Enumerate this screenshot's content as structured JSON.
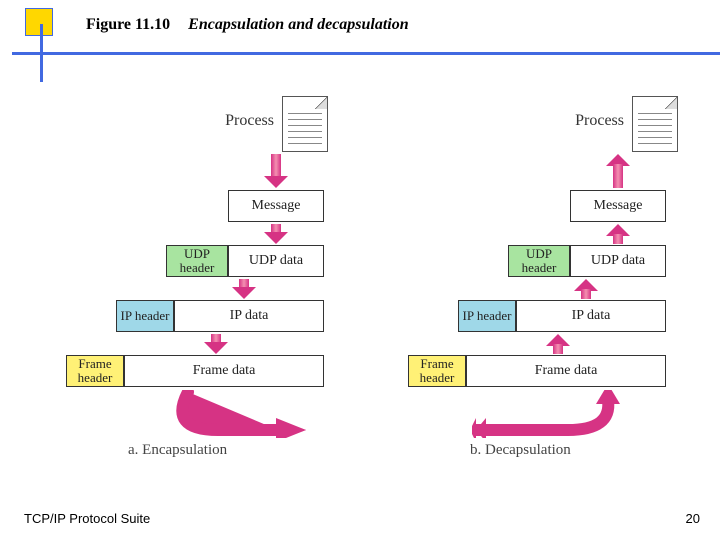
{
  "figure": {
    "number": "Figure 11.10",
    "title": "Encapsulation and decapsulation"
  },
  "labels": {
    "process": "Process",
    "message": "Message",
    "udp_header": "UDP header",
    "udp_data": "UDP  data",
    "ip_header": "IP header",
    "ip_data": "IP data",
    "frame_header": "Frame header",
    "frame_data": "Frame data"
  },
  "captions": {
    "left": "a. Encapsulation",
    "right": "b. Decapsulation"
  },
  "footer": {
    "left": "TCP/IP Protocol Suite",
    "page": "20"
  },
  "colors": {
    "rule": "#4169e1",
    "accent_yellow": "#ffd700",
    "udp_header": "#a8e4a0",
    "ip_header": "#9fd8e8",
    "frame_header": "#fff176",
    "arrow": "#d63384"
  }
}
